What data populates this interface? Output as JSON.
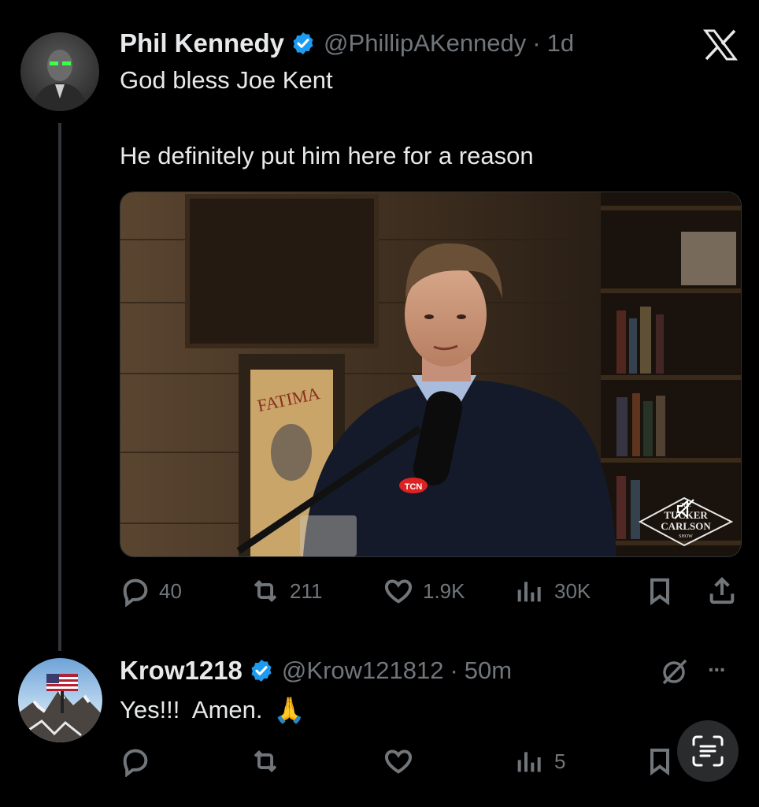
{
  "tweet": {
    "author_name": "Phil Kennedy",
    "handle": "@PhillipAKennedy",
    "sep": "·",
    "time": "1d",
    "line1": "God bless Joe Kent",
    "line2": "He definitely put him here for a reason",
    "video": {
      "poster_text": "FATIMA",
      "mic_text": "TCN",
      "logo_top": "THE",
      "logo_main1": "TUCKER",
      "logo_main2": "CARLSON",
      "logo_bottom": "SHOW"
    },
    "actions": {
      "replies": "40",
      "reposts": "211",
      "likes": "1.9K",
      "views": "30K"
    }
  },
  "reply": {
    "author_name": "Krow1218",
    "handle": "@Krow121812",
    "sep": "·",
    "time": "50m",
    "text": "Yes!!!  Amen.",
    "emoji": "🙏",
    "more": "···",
    "actions": {
      "views": "5"
    }
  },
  "colors": {
    "background": "#000000",
    "text": "#e7e9ea",
    "muted": "#71767b",
    "verified": "#1d9bf0"
  }
}
